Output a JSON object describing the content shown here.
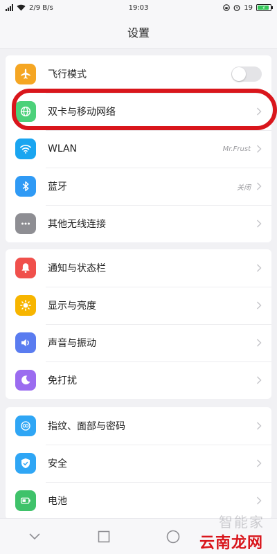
{
  "status_bar": {
    "left_text": "2/9 B/s",
    "time": "19:03",
    "battery_text": "19"
  },
  "header": {
    "title": "设置"
  },
  "groups": [
    {
      "items": [
        {
          "label": "飞行模式",
          "icon": "airplane-icon",
          "color": "#f5a623",
          "control": "toggle",
          "toggle_on": false
        },
        {
          "label": "双卡与移动网络",
          "icon": "globe-icon",
          "color": "#4cd17a",
          "control": "chevron"
        },
        {
          "label": "WLAN",
          "icon": "wifi-icon",
          "color": "#1aa5f0",
          "control": "chevron",
          "value": "Mr.Frust"
        },
        {
          "label": "蓝牙",
          "icon": "bluetooth-icon",
          "color": "#2f9af5",
          "control": "chevron",
          "value": "关闭"
        },
        {
          "label": "其他无线连接",
          "icon": "more-icon",
          "color": "#8e8e93",
          "control": "chevron"
        }
      ]
    },
    {
      "items": [
        {
          "label": "通知与状态栏",
          "icon": "bell-icon",
          "color": "#f0504c",
          "control": "chevron"
        },
        {
          "label": "显示与亮度",
          "icon": "sun-icon",
          "color": "#f7b500",
          "control": "chevron"
        },
        {
          "label": "声音与振动",
          "icon": "speaker-icon",
          "color": "#5a7cf0",
          "control": "chevron"
        },
        {
          "label": "免打扰",
          "icon": "moon-icon",
          "color": "#9b6cf0",
          "control": "chevron"
        }
      ]
    },
    {
      "items": [
        {
          "label": "指纹、面部与密码",
          "icon": "fingerprint-icon",
          "color": "#2fa6f5",
          "control": "chevron"
        },
        {
          "label": "安全",
          "icon": "shield-icon",
          "color": "#2fa6f5",
          "control": "chevron"
        },
        {
          "label": "电池",
          "icon": "battery-icon",
          "color": "#3fc26a",
          "control": "chevron"
        }
      ]
    }
  ],
  "watermark": {
    "top": "智能家",
    "bottom": "云南龙网"
  }
}
